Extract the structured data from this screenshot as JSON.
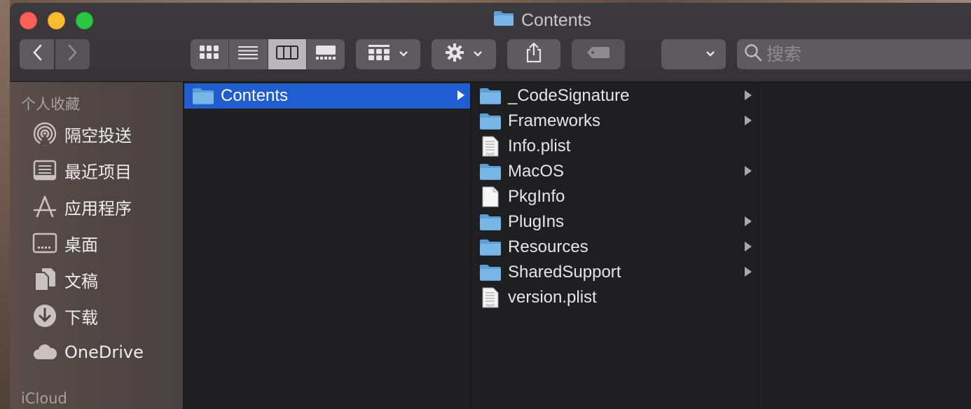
{
  "window": {
    "title": "Contents"
  },
  "toolbar": {
    "back_icon": "chevron-left-icon",
    "forward_icon": "chevron-right-icon",
    "view_modes": [
      "icon-view",
      "list-view",
      "column-view",
      "gallery-view"
    ],
    "active_view": "column-view",
    "search_placeholder": "搜索"
  },
  "sidebar": {
    "favorites_header": "个人收藏",
    "items": [
      {
        "label": "隔空投送",
        "icon": "airdrop-icon"
      },
      {
        "label": "最近项目",
        "icon": "recents-icon"
      },
      {
        "label": "应用程序",
        "icon": "applications-icon"
      },
      {
        "label": "桌面",
        "icon": "desktop-icon"
      },
      {
        "label": "文稿",
        "icon": "documents-icon"
      },
      {
        "label": "下载",
        "icon": "downloads-icon"
      },
      {
        "label": "OneDrive",
        "icon": "cloud-icon"
      }
    ],
    "icloud_header": "iCloud"
  },
  "columns": {
    "col1": [
      {
        "name": "Contents",
        "type": "folder",
        "selected": true
      }
    ],
    "col2": [
      {
        "name": "_CodeSignature",
        "type": "folder"
      },
      {
        "name": "Frameworks",
        "type": "folder"
      },
      {
        "name": "Info.plist",
        "type": "plist"
      },
      {
        "name": "MacOS",
        "type": "folder"
      },
      {
        "name": "PkgInfo",
        "type": "file"
      },
      {
        "name": "PlugIns",
        "type": "folder"
      },
      {
        "name": "Resources",
        "type": "folder"
      },
      {
        "name": "SharedSupport",
        "type": "folder"
      },
      {
        "name": "version.plist",
        "type": "plist"
      }
    ]
  },
  "plist_badge": "PLIST",
  "colors": {
    "selection": "#1f5dd1",
    "folder": "#6aaee0"
  }
}
